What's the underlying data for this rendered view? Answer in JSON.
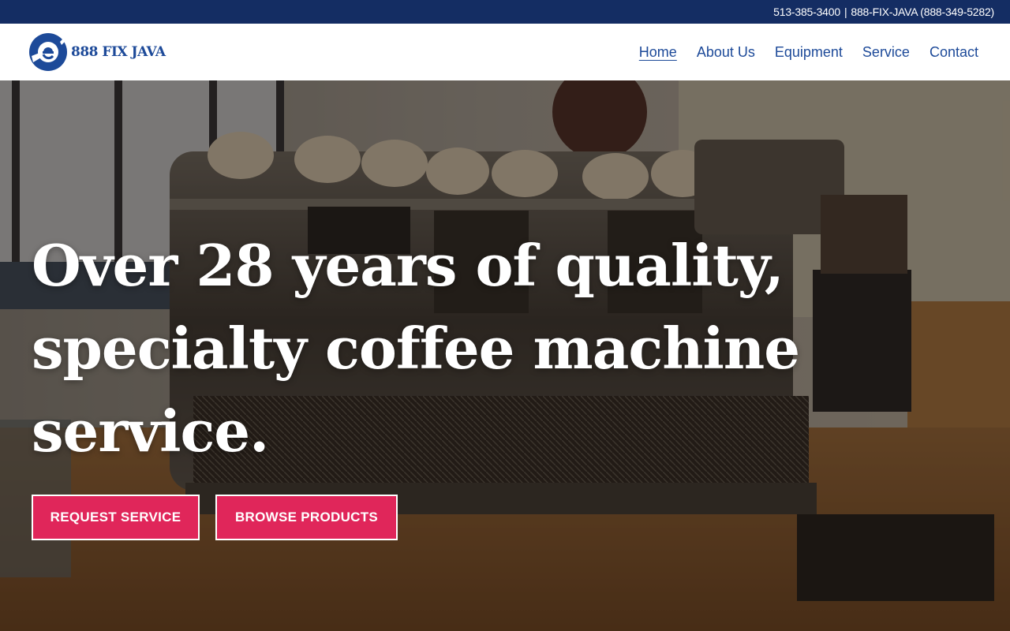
{
  "topbar": {
    "phone_primary": "513-385-3400",
    "separator": "|",
    "phone_secondary": "888-FIX-JAVA (888-349-5282)"
  },
  "brand": {
    "name": "888 FIX JAVA",
    "logo_icon": "wrench-e-logo-icon",
    "color": "#1d4a99"
  },
  "nav": {
    "items": [
      {
        "label": "Home",
        "active": true
      },
      {
        "label": "About Us"
      },
      {
        "label": "Equipment"
      },
      {
        "label": "Service"
      },
      {
        "label": "Contact"
      }
    ]
  },
  "hero": {
    "headline_lines": [
      "Over 28 years of quality,",
      "specialty coffee machine",
      "service."
    ],
    "buttons": {
      "request_label": "REQUEST SERVICE",
      "browse_label": "BROWSE PRODUCTS"
    },
    "background": "espresso-machine-photo"
  },
  "colors": {
    "topbar": "#142d63",
    "accent": "#e0265a",
    "nav_text": "#1d4a99"
  }
}
